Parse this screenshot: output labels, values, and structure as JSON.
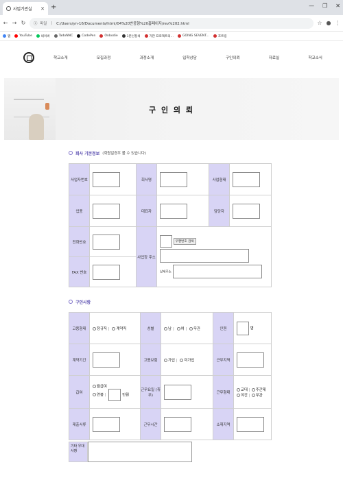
{
  "browser": {
    "tab_title": "사업기관실",
    "new_tab": "+",
    "url_scheme": "파일",
    "url": "C:/Users/yn-16/Documents/html/04%20반응형%20홈페이지/rev%202.html",
    "bookmarks": [
      {
        "label": "앱",
        "color": "#4285f4"
      },
      {
        "label": "YouTube",
        "color": "#ff0000"
      },
      {
        "label": "네이버",
        "color": "#03c75a"
      },
      {
        "label": "TadoNNC",
        "color": "#666666"
      },
      {
        "label": "CodePen",
        "color": "#111111"
      },
      {
        "label": "Onbodie",
        "color": "#d23030"
      },
      {
        "label": "1분선정석",
        "color": "#333333"
      },
      {
        "label": "거만 프로젝트의...",
        "color": "#d23030"
      },
      {
        "label": "GOING SEVENT...",
        "color": "#d23030"
      },
      {
        "label": "조트링",
        "color": "#d23030"
      }
    ]
  },
  "site": {
    "menu": [
      "학교소개",
      "모집과정",
      "과정소개",
      "입학상담",
      "구인의뢰",
      "자료실",
      "학교소식"
    ],
    "hero_title": "구 인 의 뢰"
  },
  "company": {
    "title": "회사 기본정보",
    "note": "(회원일경우 볼 수 있습니다)",
    "labels": {
      "biz_no": "사업자번호",
      "company_name": "회사명",
      "biz_type": "사업형태",
      "industry": "업종",
      "ceo": "대표자",
      "manager": "담당자",
      "phone": "전화번호",
      "address": "사업장 주소",
      "fax": "FAX 번호",
      "zip_button": "우편번호 검색",
      "detail_addr": "상세주소"
    }
  },
  "recruit": {
    "title": "구인사항",
    "labels": {
      "employ_type": "고용형태",
      "gender": "성별",
      "headcount": "인원",
      "headcount_unit": "명",
      "contract": "계약기간",
      "insurance": "고용보험",
      "work_area": "근무지역",
      "pay": "급여",
      "work_hours": "근무요일 (휴무)",
      "shift": "근무형태",
      "docs": "제출서류",
      "work_time": "근무시간",
      "contact": "소재지역"
    },
    "options": {
      "employ": [
        "정규직",
        "계약직"
      ],
      "gender": [
        "남",
        "여",
        "무관"
      ],
      "insurance": [
        "가입",
        "미가입"
      ],
      "pay": [
        "월급여",
        "연봉"
      ],
      "pay_unit": "만원",
      "shift_a": [
        "교대",
        "주간제"
      ],
      "shift_b": [
        "야간",
        "무관"
      ]
    },
    "extra_label": "기타 우대사항"
  },
  "colors": {
    "accent": "#5b4fb0",
    "label_bg": "#d8d4f5"
  }
}
